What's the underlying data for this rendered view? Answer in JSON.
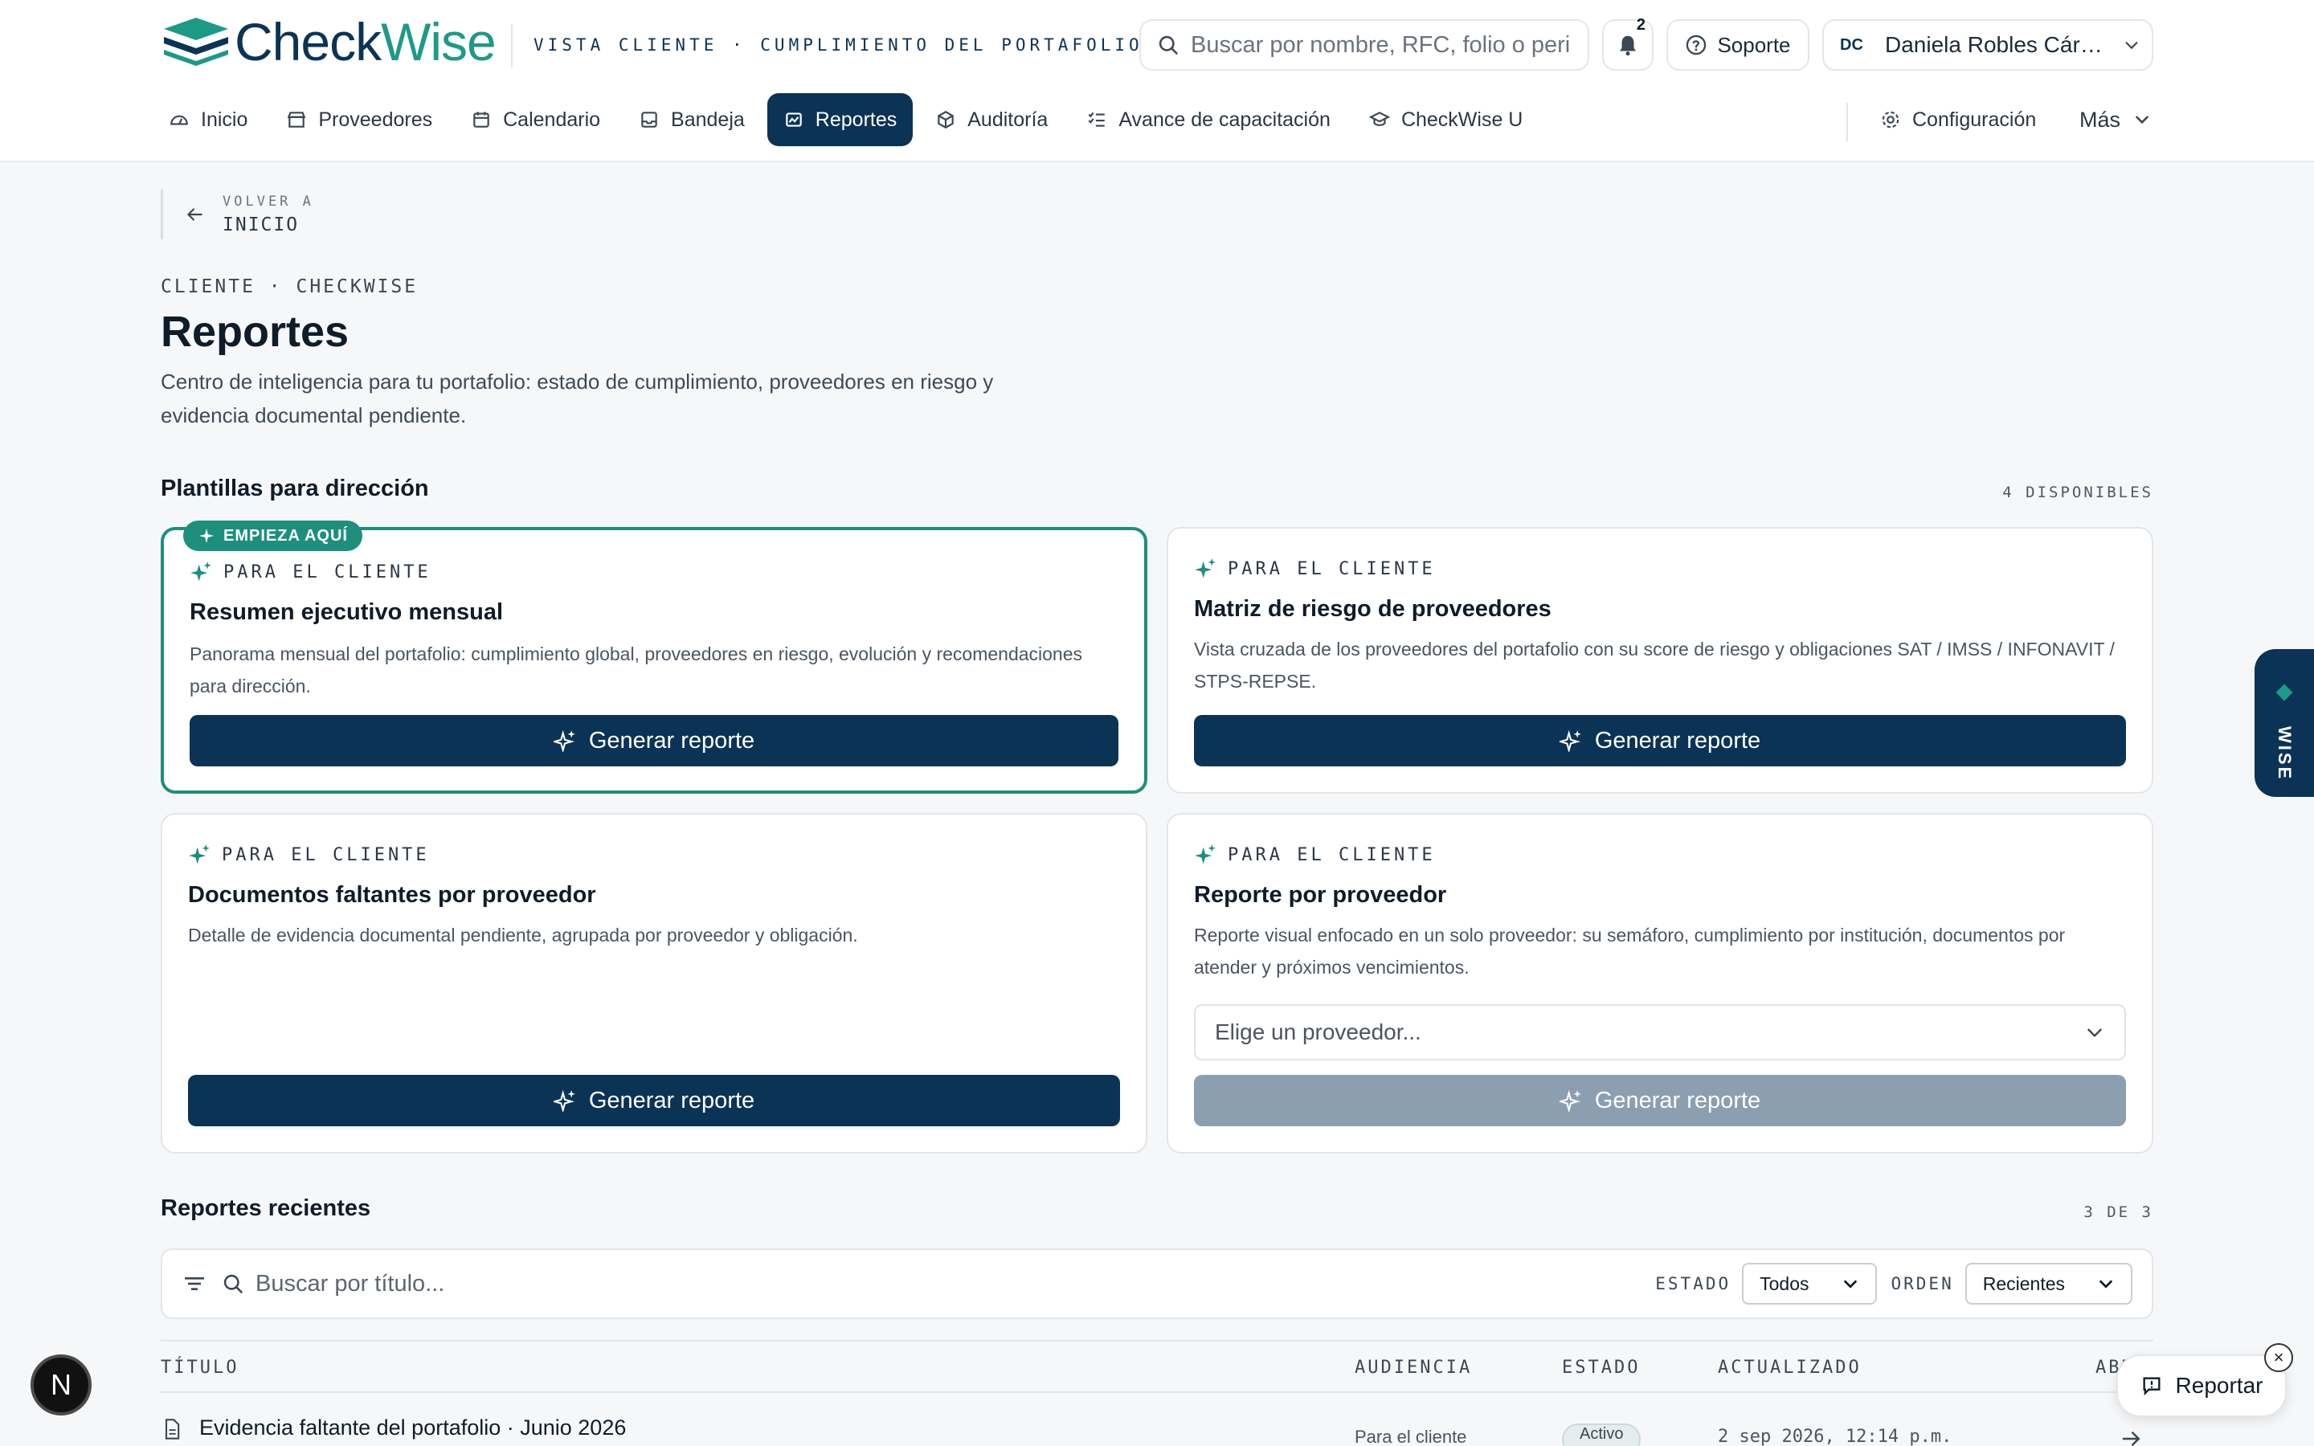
{
  "brand": {
    "name_part1": "Check",
    "name_part2": "Wise",
    "tagline": "VISTA CLIENTE · CUMPLIMIENTO DEL PORTAFOLIO"
  },
  "header": {
    "search_placeholder": "Buscar por nombre, RFC, folio o peri",
    "notifications_count": "2",
    "support_label": "Soporte",
    "user_initials": "DC",
    "user_name": "Daniela Robles Cárd..."
  },
  "nav": {
    "items": [
      {
        "label": "Inicio",
        "icon": "gauge-icon"
      },
      {
        "label": "Proveedores",
        "icon": "store-icon"
      },
      {
        "label": "Calendario",
        "icon": "calendar-icon"
      },
      {
        "label": "Bandeja",
        "icon": "inbox-icon"
      },
      {
        "label": "Reportes",
        "icon": "report-icon",
        "active": true
      },
      {
        "label": "Auditoría",
        "icon": "cube-icon"
      },
      {
        "label": "Avance de capacitación",
        "icon": "checklist-icon"
      },
      {
        "label": "CheckWise U",
        "icon": "graduation-cap-icon"
      }
    ],
    "config_label": "Configuración",
    "more_label": "Más"
  },
  "back": {
    "small": "VOLVER A",
    "big": "INICIO"
  },
  "page": {
    "breadcrumb": "CLIENTE · CHECKWISE",
    "title": "Reportes",
    "description": "Centro de inteligencia para tu portafolio: estado de cumplimiento, proveedores en riesgo y evidencia documental pendiente."
  },
  "templates": {
    "section_title": "Plantillas para dirección",
    "count": "4 DISPONIBLES",
    "featured_pill": "EMPIEZA AQUÍ",
    "cards": [
      {
        "tag": "PARA EL CLIENTE",
        "title": "Resumen ejecutivo mensual",
        "description": "Panorama mensual del portafolio: cumplimiento global, proveedores en riesgo, evolución y recomendaciones para dirección.",
        "button": "Generar reporte"
      },
      {
        "tag": "PARA EL CLIENTE",
        "title": "Matriz de riesgo de proveedores",
        "description": "Vista cruzada de los proveedores del portafolio con su score de riesgo y obligaciones SAT / IMSS / INFONAVIT / STPS-REPSE.",
        "button": "Generar reporte"
      },
      {
        "tag": "PARA EL CLIENTE",
        "title": "Documentos faltantes por proveedor",
        "description": "Detalle de evidencia documental pendiente, agrupada por proveedor y obligación.",
        "button": "Generar reporte"
      },
      {
        "tag": "PARA EL CLIENTE",
        "title": "Reporte por proveedor",
        "description": "Reporte visual enfocado en un solo proveedor: su semáforo, cumplimiento por institución, documentos por atender y próximos vencimientos.",
        "select_placeholder": "Elige un proveedor...",
        "button": "Generar reporte"
      }
    ]
  },
  "recent": {
    "section_title": "Reportes recientes",
    "count": "3 DE 3",
    "search_placeholder": "Buscar por título...",
    "estado_label": "ESTADO",
    "estado_value": "Todos",
    "orden_label": "ORDEN",
    "orden_value": "Recientes",
    "columns": [
      "TÍTULO",
      "AUDIENCIA",
      "ESTADO",
      "ACTUALIZADO",
      "ABR"
    ],
    "rows": [
      {
        "title": "Evidencia faltante del portafolio · Junio 2026",
        "audience": "Para el cliente",
        "status": "Activo",
        "updated": "2 sep 2026, 12:14 p.m."
      }
    ]
  },
  "floating": {
    "wise_label": "WISE",
    "n_label": "N",
    "report_label": "Reportar"
  },
  "colors": {
    "primary": "#0b3356",
    "accent": "#1d8f7c",
    "disabled": "#8b9fb1"
  }
}
